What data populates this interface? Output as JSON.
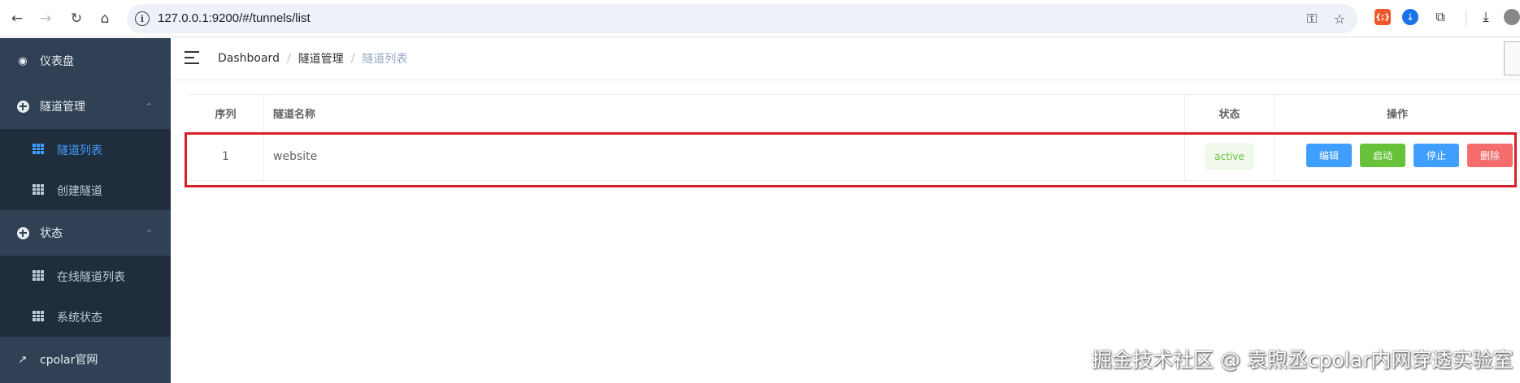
{
  "browser": {
    "url": "127.0.0.1:9200/#/tunnels/list"
  },
  "sidebar": {
    "items": [
      {
        "label": "仪表盘",
        "icon": "dashboard-icon"
      },
      {
        "label": "隧道管理",
        "icon": "plus-circle-icon",
        "expanded": true,
        "children": [
          {
            "label": "隧道列表",
            "active": true
          },
          {
            "label": "创建隧道",
            "active": false
          }
        ]
      },
      {
        "label": "状态",
        "icon": "plus-circle-icon",
        "expanded": true,
        "children": [
          {
            "label": "在线隧道列表",
            "active": false
          },
          {
            "label": "系统状态",
            "active": false
          }
        ]
      },
      {
        "label": "cpolar官网",
        "icon": "external-link-icon"
      }
    ]
  },
  "breadcrumb": {
    "items": [
      "Dashboard",
      "隧道管理",
      "隧道列表"
    ]
  },
  "table": {
    "columns": [
      "序列",
      "隧道名称",
      "状态",
      "操作"
    ],
    "rows": [
      {
        "index": "1",
        "name": "website",
        "status": "active"
      }
    ],
    "actions": {
      "edit": "编辑",
      "start": "启动",
      "stop": "停止",
      "delete": "删除"
    }
  },
  "watermark": "掘金技术社区 @ 袁煦丞cpolar内网穿透实验室",
  "colors": {
    "sidebar_bg": "#304156",
    "submenu_bg": "#1f2d3d",
    "accent": "#409eff",
    "success": "#67c23a",
    "danger": "#f56c6c",
    "highlight": "#d9202a"
  }
}
